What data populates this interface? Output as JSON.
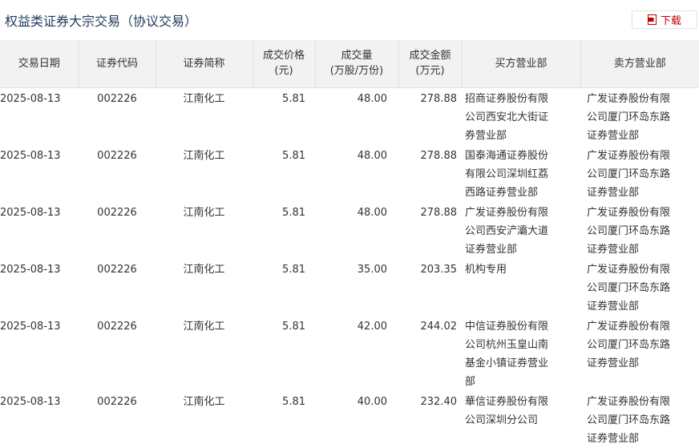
{
  "header": {
    "title": "权益类证券大宗交易（协议交易）",
    "download_label": "下载"
  },
  "table": {
    "columns": [
      "交易日期",
      "证券代码",
      "证券简称",
      "成交价格\n(元)",
      "成交量\n(万股/万份)",
      "成交金额\n(万元)",
      "买方营业部",
      "卖方营业部"
    ],
    "rows": [
      {
        "date": "2025-08-13",
        "code": "002226",
        "name": "江南化工",
        "price": "5.81",
        "volume": "48.00",
        "amount": "278.88",
        "buyer": "招商证券股份有限公司西安北大街证券营业部",
        "seller": "广发证券股份有限公司厦门环岛东路证券营业部"
      },
      {
        "date": "2025-08-13",
        "code": "002226",
        "name": "江南化工",
        "price": "5.81",
        "volume": "48.00",
        "amount": "278.88",
        "buyer": "国泰海通证券股份有限公司深圳红荔西路证券营业部",
        "seller": "广发证券股份有限公司厦门环岛东路证券营业部"
      },
      {
        "date": "2025-08-13",
        "code": "002226",
        "name": "江南化工",
        "price": "5.81",
        "volume": "48.00",
        "amount": "278.88",
        "buyer": "广发证券股份有限公司西安浐灞大道证券营业部",
        "seller": "广发证券股份有限公司厦门环岛东路证券营业部"
      },
      {
        "date": "2025-08-13",
        "code": "002226",
        "name": "江南化工",
        "price": "5.81",
        "volume": "35.00",
        "amount": "203.35",
        "buyer": "机构专用",
        "seller": "广发证券股份有限公司厦门环岛东路证券营业部"
      },
      {
        "date": "2025-08-13",
        "code": "002226",
        "name": "江南化工",
        "price": "5.81",
        "volume": "42.00",
        "amount": "244.02",
        "buyer": "中信证券股份有限公司杭州玉皇山南基金小镇证券营业部",
        "seller": "广发证券股份有限公司厦门环岛东路证券营业部"
      },
      {
        "date": "2025-08-13",
        "code": "002226",
        "name": "江南化工",
        "price": "5.81",
        "volume": "40.00",
        "amount": "232.40",
        "buyer": "華信证券股份有限公司深圳分公司",
        "seller": "广发证券股份有限公司厦门环岛东路证券营业部"
      }
    ]
  },
  "colors": {
    "title": "#1f3a5f",
    "download": "#c40000",
    "header_bg": "#f2f2f2",
    "border": "#e2e2e2"
  },
  "icons": {
    "download": "file-icon"
  }
}
